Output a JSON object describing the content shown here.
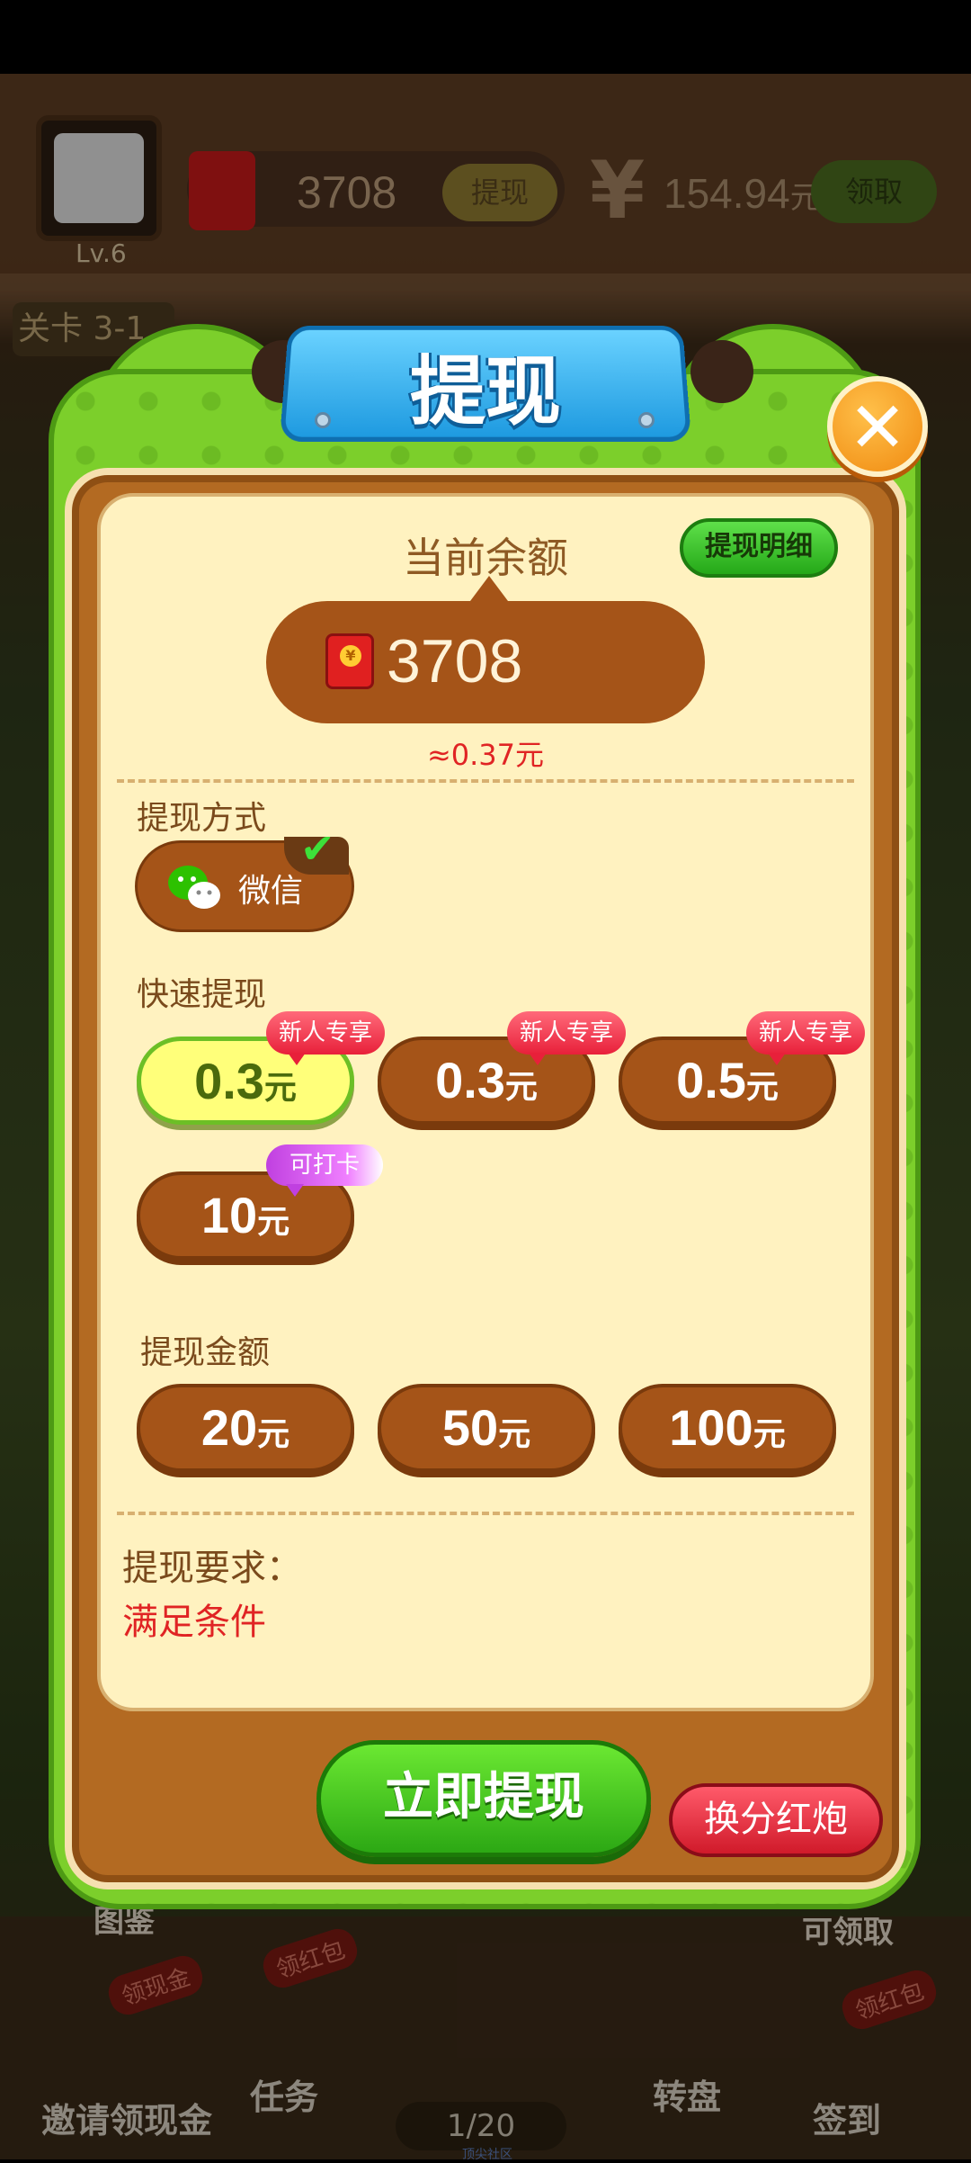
{
  "header": {
    "level": "Lv.6",
    "coins": "3708",
    "withdraw_small": "提现",
    "yen": "¥",
    "money": "154.94",
    "money_unit": "元",
    "claim": "领取",
    "stage": "关卡 3-1"
  },
  "background": {
    "nav_invite": "邀请领现金",
    "nav_task": "任务",
    "nav_wheel": "转盘",
    "nav_checkin": "签到",
    "badge_cash": "领现金",
    "badge_red1": "领红包",
    "badge_red2": "领红包",
    "progress": "1/20",
    "side_tujian": "图鉴",
    "side_claimable": "可领取",
    "watermark": "顶尖社区"
  },
  "dialog": {
    "title": "提现",
    "close_icon": "close-icon",
    "detail_button": "提现明细",
    "balance_label": "当前余额",
    "balance_value": "3708",
    "balance_approx": "≈0.37元",
    "method_label": "提现方式",
    "method_name": "微信",
    "quick_label": "快速提现",
    "quick_options": [
      {
        "amount": "0.3",
        "unit": "元",
        "tag": "新人专享"
      },
      {
        "amount": "0.3",
        "unit": "元",
        "tag": "新人专享"
      },
      {
        "amount": "0.5",
        "unit": "元",
        "tag": "新人专享"
      },
      {
        "amount": "10",
        "unit": "元",
        "tag": "可打卡"
      }
    ],
    "amount_label": "提现金额",
    "amount_options": [
      {
        "amount": "20",
        "unit": "元"
      },
      {
        "amount": "50",
        "unit": "元"
      },
      {
        "amount": "100",
        "unit": "元"
      }
    ],
    "requirement_label": "提现要求：",
    "requirement_value": "满足条件",
    "withdraw_button": "立即提现",
    "exchange_button": "换分红炮"
  },
  "colors": {
    "frame_green": "#7ccf2b",
    "panel_brown": "#b36a22",
    "cream": "#fff2c0",
    "button_brown": "#a55418",
    "highlight_red": "#e02424",
    "title_blue": "#1e9ae0"
  }
}
